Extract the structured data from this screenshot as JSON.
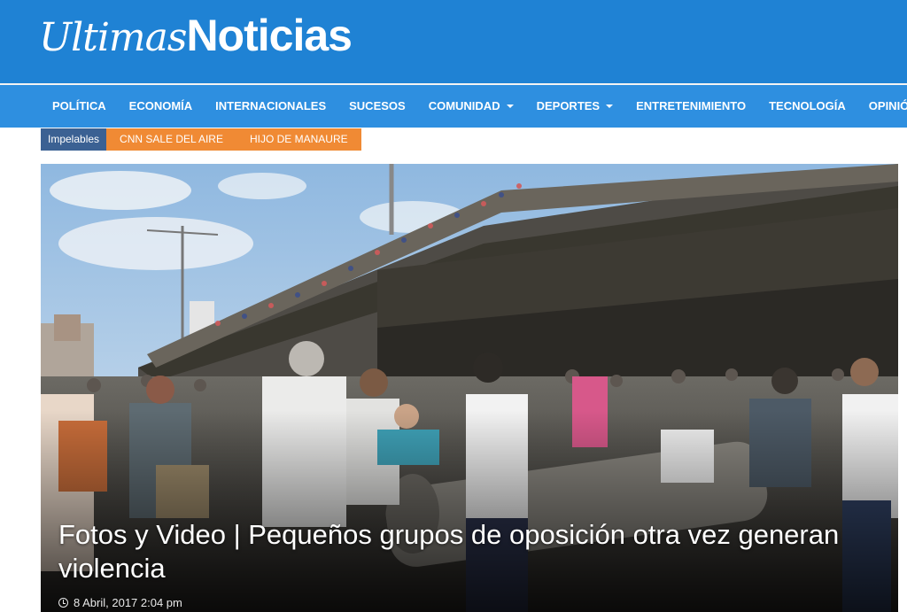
{
  "site": {
    "logo_part1": "Ultimas",
    "logo_part2": "Noticias",
    "header_color": "#1f82d4",
    "nav_color": "#2e8fe0"
  },
  "nav": {
    "items": [
      {
        "label": "POLÍTICA",
        "dropdown": false
      },
      {
        "label": "ECONOMÍA",
        "dropdown": false
      },
      {
        "label": "INTERNACIONALES",
        "dropdown": false
      },
      {
        "label": "SUCESOS",
        "dropdown": false
      },
      {
        "label": "COMUNIDAD",
        "dropdown": true
      },
      {
        "label": "DEPORTES",
        "dropdown": true
      },
      {
        "label": "ENTRETENIMIENTO",
        "dropdown": false
      },
      {
        "label": "TECNOLOGÍA",
        "dropdown": false
      },
      {
        "label": "OPINIÓN",
        "dropdown": false
      }
    ]
  },
  "trending": {
    "label": "Impelables",
    "label_color": "#3b6193",
    "tag_color": "#f08a34",
    "items": [
      "CNN SALE DEL AIRE",
      "HIJO DE MANAURE"
    ]
  },
  "feature": {
    "headline": "Fotos y Video | Pequeños grupos de oposición otra vez generan violencia",
    "date": "8 Abril, 2017 2:04 pm",
    "date_icon": "clock-icon"
  }
}
